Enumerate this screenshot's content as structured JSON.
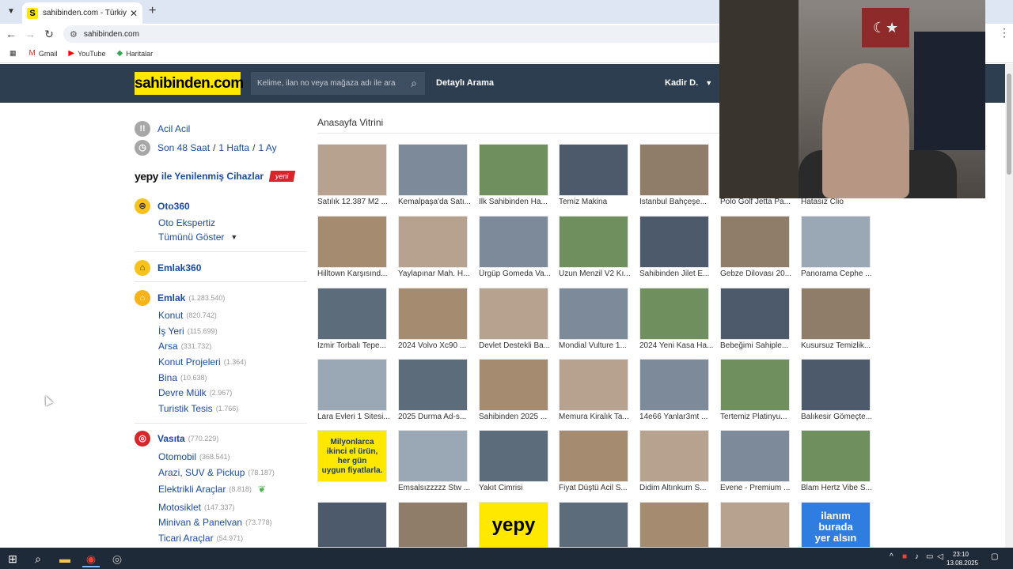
{
  "browser": {
    "tab_title": "sahibinden.com - Türkiye'nin O",
    "tab_favicon": "S",
    "url": "sahibinden.com",
    "bookmarks": [
      {
        "label": "Gmail",
        "icon": "gmail-icon"
      },
      {
        "label": "YouTube",
        "icon": "youtube-icon"
      },
      {
        "label": "Haritalar",
        "icon": "maps-icon"
      }
    ]
  },
  "header": {
    "logo": "sahibinden.com",
    "search_placeholder": "Kelime, ilan no veya mağaza adı ile ara",
    "advanced_search": "Detaylı Arama",
    "user_name": "Kadir D."
  },
  "sidebar": {
    "acil": "Acil Acil",
    "son48": "Son 48 Saat",
    "hafta": "1 Hafta",
    "ay": "1 Ay",
    "slash": "/",
    "yepy_brand": "yepy",
    "yepy_text": "ile Yenilenmiş Cihazlar",
    "yeni": "yeni",
    "oto360": "Oto360",
    "oto_ekspertiz": "Oto Ekspertiz",
    "tumunu_goster": "Tümünü Göster",
    "emlak360": "Emlak360",
    "emlak": {
      "label": "Emlak",
      "count": "(1.283.540)"
    },
    "emlak_items": [
      {
        "label": "Konut",
        "count": "(820.742)"
      },
      {
        "label": "İş Yeri",
        "count": "(115.699)"
      },
      {
        "label": "Arsa",
        "count": "(331.732)"
      },
      {
        "label": "Konut Projeleri",
        "count": "(1.364)"
      },
      {
        "label": "Bina",
        "count": "(10.638)"
      },
      {
        "label": "Devre Mülk",
        "count": "(2.967)"
      },
      {
        "label": "Turistik Tesis",
        "count": "(1.766)"
      }
    ],
    "vasita": {
      "label": "Vasıta",
      "count": "(770.229)"
    },
    "vasita_items": [
      {
        "label": "Otomobil",
        "count": "(368.541)"
      },
      {
        "label": "Arazi, SUV & Pickup",
        "count": "(78.187)"
      },
      {
        "label": "Elektrikli Araçlar",
        "count": "(8.818)"
      },
      {
        "label": "Motosiklet",
        "count": "(147.337)"
      },
      {
        "label": "Minivan & Panelvan",
        "count": "(73.778)"
      },
      {
        "label": "Ticari Araçlar",
        "count": "(54.971)"
      }
    ]
  },
  "vitrin": {
    "title": "Anasayfa Vitrini",
    "rows": [
      [
        "Satılık 12.387 M2 ...",
        "Kemalpaşa'da Satı...",
        "İlk Sahibinden Ha...",
        "Temiz Makina",
        "İstanbul Bahçeşe...",
        "Polo Golf Jetta Pa...",
        "Hatasız Clio"
      ],
      [
        "Hilltown Karşısınd...",
        "Yaylapınar Mah. H...",
        "Ürgüp Gomeda Va...",
        "Uzun Menzil V2 Kı...",
        "Sahibinden Jilet E...",
        "Gebze Dilovası 20...",
        "Panorama Cephe ..."
      ],
      [
        "İzmir Torbalı Tepe...",
        "2024 Volvo Xc90 ...",
        "Devlet Destekli Ba...",
        "Mondial Vulture 1...",
        "2024 Yeni Kasa Ha...",
        "Bebeğimi Sahiple...",
        "Kusursuz Temizlik..."
      ],
      [
        "Lara Evleri 1 Sitesi...",
        "2025 Durma Ad-s...",
        "Sahibinden 2025 ...",
        "Memura Kiralık Ta...",
        "14e66 Yanlar3mt ...",
        "Tertemiz Platinyu...",
        "Balıkesir Gömeçte..."
      ],
      [
        "",
        "Emsalsızzzzz Stw ...",
        "Yakıt Cimrisi",
        "Fiyat Düştü Acil S...",
        "Didim Altınkum S...",
        "Evene - Premium ...",
        "Blam Hertz Vibe S..."
      ]
    ],
    "promo_lines": [
      "Milyonlarca",
      "ikinci el ürün,",
      "her gün",
      "uygun fiyatlarla."
    ],
    "yepy_tile": "yepy",
    "ilan_tile": [
      "ilanım",
      "burada",
      "yer alsın"
    ]
  },
  "webcam": {
    "flag_symbol": "☾★"
  },
  "taskbar": {
    "time": "23:10",
    "date": "13.08.2025"
  },
  "colors": {
    "brand_yellow": "#ffe800",
    "header_bg": "#2d3e50",
    "link_blue": "#1a4b9e"
  }
}
